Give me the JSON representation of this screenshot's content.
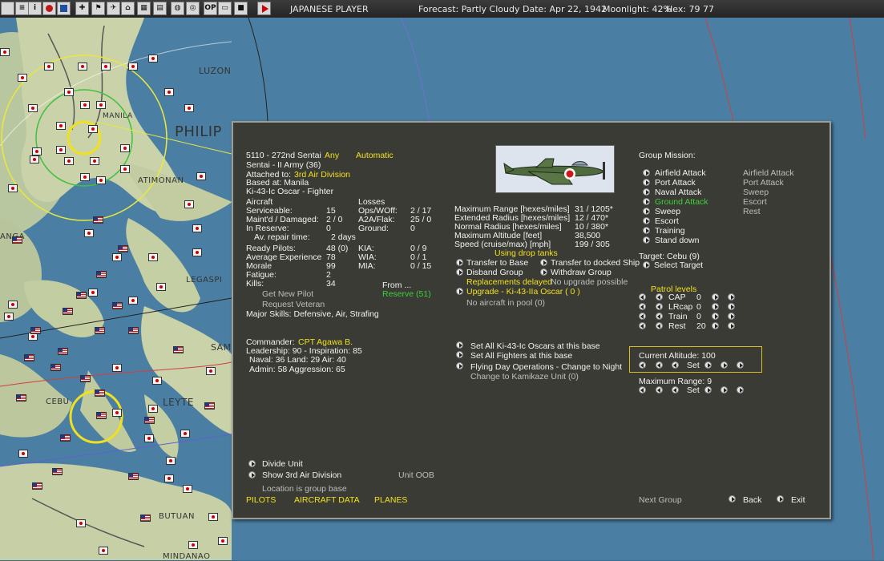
{
  "topbar": {
    "player": "JAPANESE PLAYER",
    "forecast": "Forecast: Partly Cloudy",
    "date": "Date: Apr 22, 1942",
    "moonlight": "Moonlight: 42%",
    "hex": "Hex: 79 77",
    "buttons": [
      {
        "icon": "menu-icon",
        "glyph": ""
      },
      {
        "icon": "list-icon",
        "glyph": "≡"
      },
      {
        "icon": "info-icon",
        "glyph": "i"
      },
      {
        "icon": "rising-sun-icon",
        "glyph": ""
      },
      {
        "icon": "ship-icon",
        "glyph": ""
      },
      {
        "icon": "cross-icon",
        "glyph": "✚"
      },
      {
        "icon": "flag-icon",
        "glyph": "⚑"
      },
      {
        "icon": "plane-icon",
        "glyph": "✈"
      },
      {
        "icon": "ground-icon",
        "glyph": "⌂"
      },
      {
        "icon": "building-icon",
        "glyph": "▦"
      },
      {
        "icon": "map-icon",
        "glyph": "▤"
      },
      {
        "icon": "globe-icon",
        "glyph": "◍"
      },
      {
        "icon": "target-icon",
        "glyph": "◎"
      },
      {
        "icon": "op-icon",
        "glyph": "OP"
      },
      {
        "icon": "window-icon",
        "glyph": "▭"
      },
      {
        "icon": "screen-icon",
        "glyph": "■"
      },
      {
        "icon": "play-icon",
        "glyph": ""
      }
    ]
  },
  "map": {
    "labels": [
      "LUZON",
      "MANILA",
      "PHILIP",
      "ATIMONAN",
      "ANGA",
      "LEGASPI",
      "SAM",
      "CEBU",
      "LEYTE",
      "BUTUAN",
      "MINDANAO"
    ]
  },
  "panel": {
    "unit_name": "5110 - 272nd Sentai",
    "any": "Any",
    "automatic": "Automatic",
    "army": "Sentai - II Army (36)",
    "attached_label": "Attached to:",
    "attached_value": "3rd Air Division",
    "based_at": "Based at:  Manila",
    "aircraft_type": "Ki-43-Ic Oscar - Fighter",
    "aircraft_header": "Aircraft",
    "losses_header": "Losses",
    "stats_left": [
      {
        "label": "Serviceable:",
        "value": "15"
      },
      {
        "label": "Maint'd / Damaged:",
        "value": "2 / 0"
      },
      {
        "label": "In Reserve:",
        "value": "0"
      },
      {
        "label": "Av. repair time:",
        "value": "2 days"
      }
    ],
    "stats_losses": [
      {
        "label": "Ops/WOff:",
        "value": "2 / 17"
      },
      {
        "label": "A2A/Flak:",
        "value": "25 / 0"
      },
      {
        "label": "Ground:",
        "value": "0"
      }
    ],
    "pilot_stats": [
      {
        "label": "Ready Pilots:",
        "value": "48 (0)"
      },
      {
        "label": "Average Experience",
        "value": "78"
      },
      {
        "label": "Morale",
        "value": "99"
      },
      {
        "label": "Fatigue:",
        "value": "2"
      },
      {
        "label": "Kills:",
        "value": "34"
      }
    ],
    "casualty_stats": [
      {
        "label": "KIA:",
        "value": "0 / 9"
      },
      {
        "label": "WIA:",
        "value": "0 / 1"
      },
      {
        "label": "MIA:",
        "value": "0 / 15"
      }
    ],
    "get_new_pilot": "Get New Pilot",
    "request_veteran": "Request Veteran",
    "from_label": "From ...",
    "reserve": "Reserve (51)",
    "major_skills": "Major Skills: Defensive, Air, Strafing",
    "commander_label": "Commander:",
    "commander_name": "CPT Agawa B.",
    "leadership": "Leadership: 90 - Inspiration: 85",
    "naval_land_air": "Naval: 36  Land: 29  Air: 40",
    "admin": "Admin: 58  Aggression: 65",
    "specs": [
      {
        "label": "Maximum Range [hexes/miles]",
        "value": "31 / 1205*"
      },
      {
        "label": "Extended Radius [hexes/miles]",
        "value": "12 / 470*"
      },
      {
        "label": "Normal Radius [hexes/miles]",
        "value": "10 / 380*"
      },
      {
        "label": "Maximum Altitude [feet]",
        "value": "38,500"
      },
      {
        "label": "Speed (cruise/max) [mph]",
        "value": "199 / 305"
      }
    ],
    "drop_tanks": "Using drop tanks",
    "transfer_to_base": "Transfer to Base",
    "transfer_to_ship": "Transfer to docked Ship",
    "disband_group": "Disband Group",
    "withdraw_group": "Withdraw Group",
    "replacements_delayed": "Replacements delayed",
    "no_upgrade": "No upgrade possible",
    "upgrade": "Upgrade - Ki-43-IIa Oscar  ( 0 )",
    "no_aircraft": "No aircraft in pool (0)",
    "set_all_oscars": "Set All Ki-43-Ic Oscars at this base",
    "set_all_fighters": "Set All Fighters at this base",
    "flying_day": "Flying Day Operations - Change to Night",
    "kamikaze": "Change to Kamikaze Unit (0)",
    "group_mission_label": "Group Mission:",
    "missions": [
      {
        "label": "Airfield Attack",
        "alt": "Airfield Attack",
        "active": false
      },
      {
        "label": "Port Attack",
        "alt": "Port Attack",
        "active": false
      },
      {
        "label": "Naval Attack",
        "alt": "Sweep",
        "active": false
      },
      {
        "label": "Ground Attack",
        "alt": "Escort",
        "active": true
      },
      {
        "label": "Sweep",
        "alt": "Rest",
        "active": false
      },
      {
        "label": "Escort",
        "alt": "",
        "active": false
      },
      {
        "label": "Training",
        "alt": "",
        "active": false
      },
      {
        "label": "Stand down",
        "alt": "",
        "active": false
      }
    ],
    "target": "Target: Cebu  (9)",
    "select_target": "Select Target",
    "patrol_label": "Patrol levels",
    "patrol": [
      {
        "label": "CAP",
        "value": "0"
      },
      {
        "label": "LRcap",
        "value": "0"
      },
      {
        "label": "Train",
        "value": "0"
      },
      {
        "label": "Rest",
        "value": "20"
      }
    ],
    "current_altitude": "Current Altitude: 100",
    "set_label": "Set",
    "max_range": "Maximum Range: 9",
    "divide_unit": "Divide Unit",
    "show_division": "Show 3rd Air Division",
    "unit_oob": "Unit OOB",
    "location_group_base": "Location is group base",
    "pilots": "PILOTS",
    "aircraft_data": "AIRCRAFT DATA",
    "planes": "PLANES",
    "next_group": "Next Group",
    "back": "Back",
    "exit": "Exit"
  }
}
